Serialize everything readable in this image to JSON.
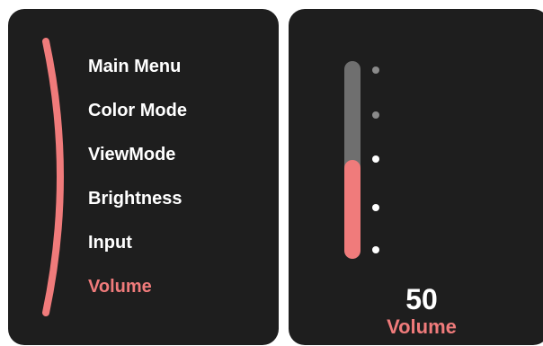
{
  "menu": {
    "items": [
      {
        "label": "Main Menu",
        "active": false
      },
      {
        "label": "Color Mode",
        "active": false
      },
      {
        "label": "ViewMode",
        "active": false
      },
      {
        "label": "Brightness",
        "active": false
      },
      {
        "label": "Input",
        "active": false
      },
      {
        "label": "Volume",
        "active": true
      }
    ]
  },
  "volume": {
    "value": "50",
    "label": "Volume",
    "level_fraction": 0.5
  },
  "colors": {
    "accent": "#f07b7b",
    "panel": "#1e1e1e",
    "track": "#6f6f6f",
    "text": "#ffffff"
  }
}
